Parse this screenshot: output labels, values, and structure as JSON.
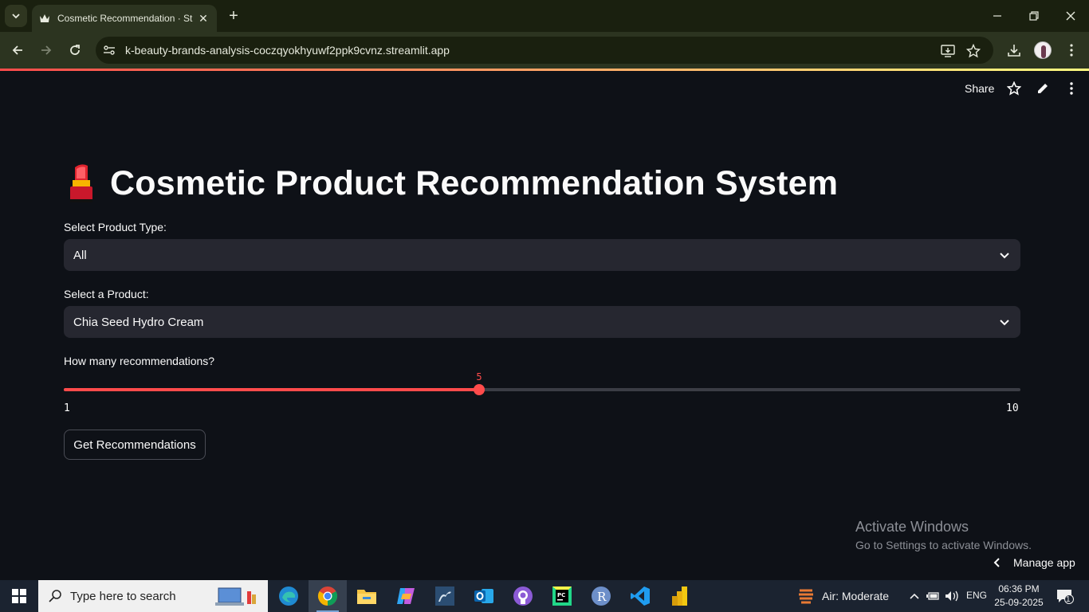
{
  "browser": {
    "tab_title": "Cosmetic Recommendation · St",
    "url": "k-beauty-brands-analysis-coczqyokhyuwf2ppk9cvnz.streamlit.app"
  },
  "app": {
    "header": {
      "share_label": "Share"
    },
    "title": "Cosmetic Product Recommendation System",
    "product_type": {
      "label": "Select Product Type:",
      "value": "All"
    },
    "product": {
      "label": "Select a Product:",
      "value": "Chia Seed Hydro Cream"
    },
    "slider": {
      "label": "How many recommendations?",
      "value": 5,
      "value_text": "5",
      "min": 1,
      "max": 10,
      "min_text": "1",
      "max_text": "10"
    },
    "button_label": "Get Recommendations",
    "manage_label": "Manage app"
  },
  "watermark": {
    "line1": "Activate Windows",
    "line2": "Go to Settings to activate Windows."
  },
  "taskbar": {
    "search_placeholder": "Type here to search",
    "air_quality": "Air: Moderate",
    "language": "ENG",
    "time": "06:36 PM",
    "date": "25-09-2025",
    "notification_count": "1",
    "apps": [
      "edge-icon",
      "chrome-icon",
      "file-explorer-icon",
      "copilot-icon",
      "mysql-workbench-icon",
      "outlook-icon",
      "github-desktop-icon",
      "pycharm-icon",
      "r-icon",
      "vscode-icon",
      "power-bi-icon"
    ]
  },
  "colors": {
    "accent": "#ff4b4b",
    "app_background": "#0e1117",
    "select_background": "#262730",
    "chrome_frame": "#1a200f",
    "chrome_toolbar": "#2c3420"
  }
}
